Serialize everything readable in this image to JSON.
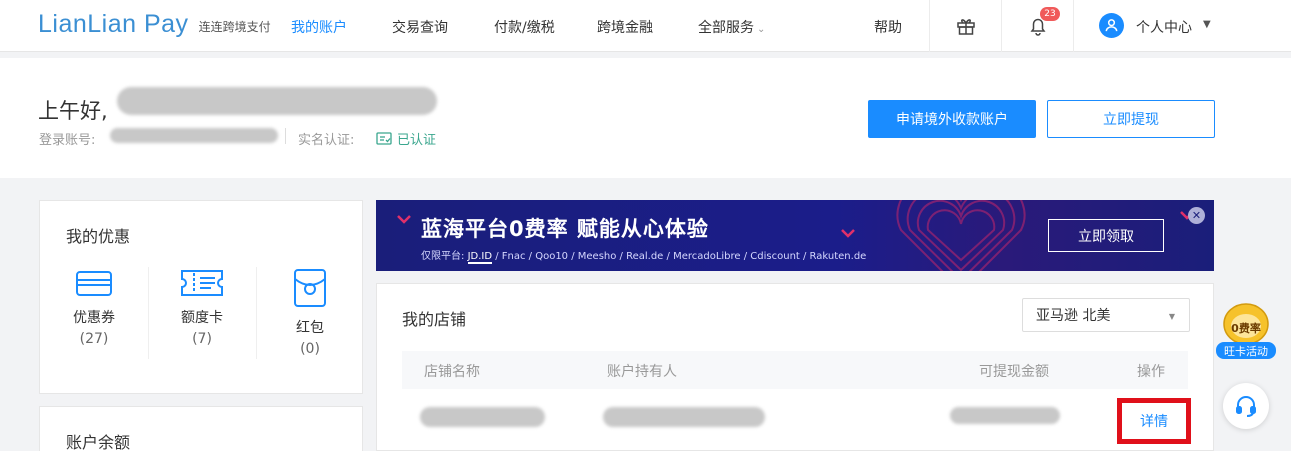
{
  "nav": {
    "logo": "LianLian Pay",
    "logo_sub": "连连跨境支付",
    "items": [
      "我的账户",
      "交易查询",
      "付款/缴税",
      "跨境金融",
      "全部服务"
    ],
    "help": "帮助",
    "notification_count": "23",
    "user_menu": "个人中心"
  },
  "header": {
    "greeting": "上午好,",
    "account_label": "登录账号:",
    "verify_label": "实名认证:",
    "verify_status": "已认证",
    "btn_apply": "申请境外收款账户",
    "btn_withdraw": "立即提现"
  },
  "offers": {
    "title": "我的优惠",
    "items": [
      {
        "label": "优惠券",
        "count": "(27)",
        "icon": "card-icon"
      },
      {
        "label": "额度卡",
        "count": "(7)",
        "icon": "ticket-icon"
      },
      {
        "label": "红包",
        "count": "(0)",
        "icon": "red-envelope-icon"
      }
    ]
  },
  "balance": {
    "title": "账户余额"
  },
  "banner": {
    "title": "蓝海平台0费率  赋能从心体验",
    "sub_prefix": "仅限平台: ",
    "sub_highlight": "JD.ID",
    "sub_rest": " / Fnac / Qoo10 / Meesho / Real.de / MercadoLibre / Cdiscount / Rakuten.de",
    "cta": "立即领取"
  },
  "stores": {
    "title": "我的店铺",
    "selected_platform": "亚马逊 北美",
    "columns": [
      "店铺名称",
      "账户持有人",
      "可提现金额",
      "操作"
    ],
    "row_action": "详情"
  },
  "float": {
    "promo_top": "0费率",
    "promo_label": "旺卡活动"
  },
  "colors": {
    "primary": "#1a8cff",
    "highlight": "#e0101a",
    "banner": "#1a1e7a"
  }
}
